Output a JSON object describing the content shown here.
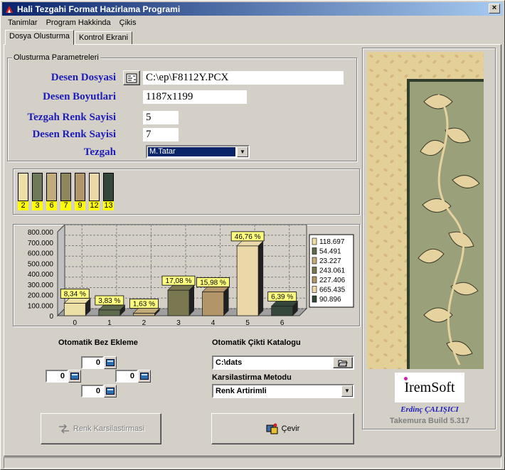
{
  "window": {
    "title": "Hali Tezgahi Format Hazirlama Programi",
    "close": "×"
  },
  "menu": [
    {
      "label": "Tanimlar"
    },
    {
      "label": "Program Hakkinda"
    },
    {
      "label": "Çikis"
    }
  ],
  "tabs": [
    {
      "label": "Dosya Olusturma"
    },
    {
      "label": "Kontrol Ekrani"
    }
  ],
  "params": {
    "group_title": "Olusturma Parametreleri",
    "desen_dosyasi_label": "Desen Dosyasi",
    "desen_dosyasi_value": "C:\\ep\\F8112Y.PCX",
    "desen_boyutlari_label": "Desen Boyutlari",
    "desen_boyutlari_value": "1187x1199",
    "tezgah_renk_label": "Tezgah Renk Sayisi",
    "tezgah_renk_value": "5",
    "desen_renk_label": "Desen Renk Sayisi",
    "desen_renk_value": "7",
    "tezgah_label": "Tezgah",
    "tezgah_value": "M.Tatar"
  },
  "swatches": [
    {
      "num": "2",
      "color": "#ede0a6"
    },
    {
      "num": "3",
      "color": "#6f7a5a"
    },
    {
      "num": "6",
      "color": "#c2ad7a"
    },
    {
      "num": "7",
      "color": "#8e875c"
    },
    {
      "num": "9",
      "color": "#b3956a"
    },
    {
      "num": "12",
      "color": "#ead8a8"
    },
    {
      "num": "13",
      "color": "#34473a"
    }
  ],
  "chart_data": {
    "type": "bar",
    "categories": [
      "0",
      "1",
      "2",
      "3",
      "4",
      "5",
      "6"
    ],
    "values": [
      118697,
      54491,
      23227,
      243061,
      227406,
      665435,
      90896
    ],
    "data_labels": [
      "8,34 %",
      "3,83 %",
      "1,63 %",
      "17,08 %",
      "15,98 %",
      "46,76 %",
      "6,39 %"
    ],
    "legend": [
      "118.697",
      "54.491",
      "23.227",
      "243.061",
      "227.406",
      "665.435",
      "90.896"
    ],
    "colors": [
      "#ede0a6",
      "#5e6a4c",
      "#c2ad7a",
      "#7a7850",
      "#b3956a",
      "#ead8a8",
      "#34473a"
    ],
    "ylim": [
      0,
      800000
    ],
    "yticks": [
      "0",
      "100.000",
      "200.000",
      "300.000",
      "400.000",
      "500.000",
      "600.000",
      "700.000",
      "800.000"
    ],
    "legend_position": "right",
    "grid": true
  },
  "bez": {
    "title": "Otomatik Bez Ekleme",
    "top": "0",
    "left": "0",
    "right": "0",
    "bottom": "0"
  },
  "output": {
    "title": "Otomatik Çikti Katalogu",
    "path": "C:\\dats",
    "method_title": "Karsilastirma Metodu",
    "method_value": "Renk Artirimli"
  },
  "buttons": {
    "compare": "Renk Karsilastirmasi",
    "convert": "Çevir"
  },
  "brand": {
    "logo": "IremSoft",
    "author": "Erdinç ÇALIŞICI",
    "build": "Takemura Build 5.317"
  }
}
